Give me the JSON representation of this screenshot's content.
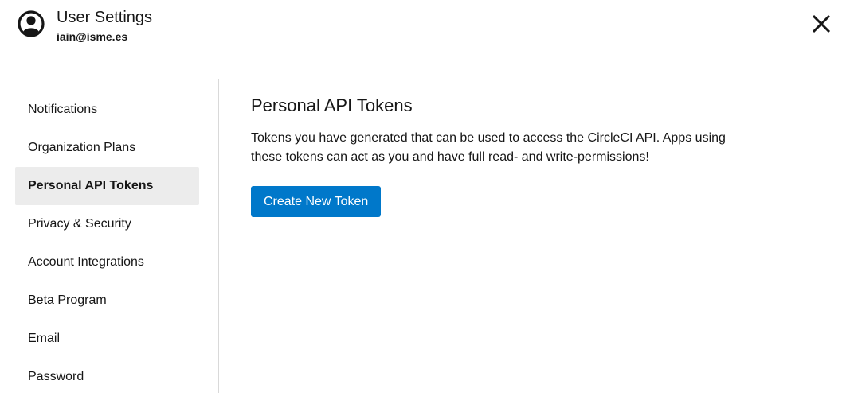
{
  "header": {
    "title": "User Settings",
    "email": "iain@isme.es",
    "avatar_icon": "user-circle-icon",
    "close_icon": "close-icon"
  },
  "sidebar": {
    "items": [
      {
        "label": "Notifications",
        "active": false
      },
      {
        "label": "Organization Plans",
        "active": false
      },
      {
        "label": "Personal API Tokens",
        "active": true
      },
      {
        "label": "Privacy & Security",
        "active": false
      },
      {
        "label": "Account Integrations",
        "active": false
      },
      {
        "label": "Beta Program",
        "active": false
      },
      {
        "label": "Email",
        "active": false
      },
      {
        "label": "Password",
        "active": false
      }
    ]
  },
  "main": {
    "title": "Personal API Tokens",
    "description": "Tokens you have generated that can be used to access the CircleCI API. Apps using these tokens can act as you and have full read- and write-permissions!",
    "create_button_label": "Create New Token"
  },
  "colors": {
    "accent": "#0078ca",
    "active_bg": "#ececec"
  }
}
